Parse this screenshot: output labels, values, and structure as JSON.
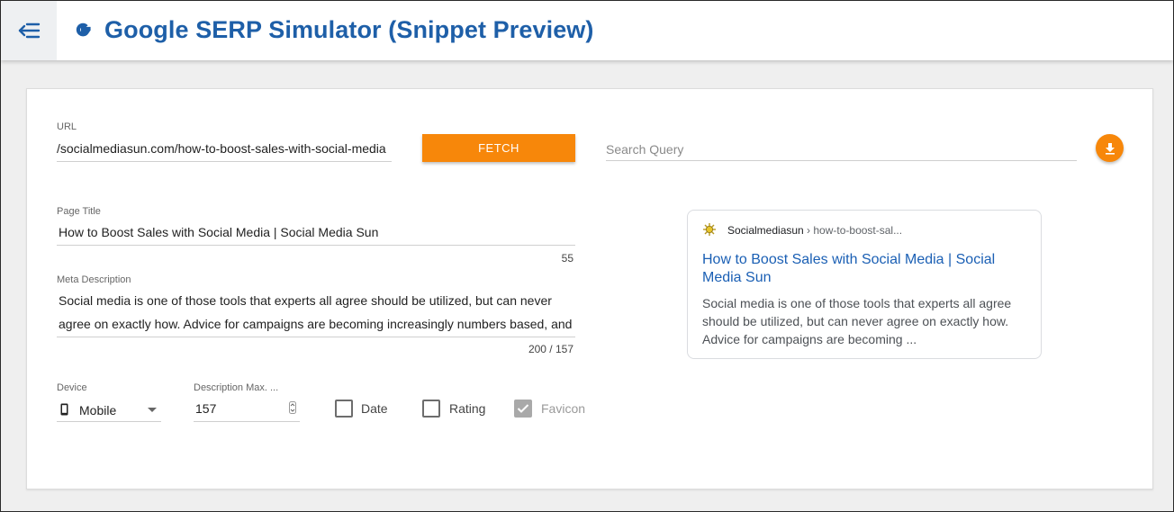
{
  "app": {
    "title": "Google SERP Simulator (Snippet Preview)"
  },
  "colors": {
    "brand_blue": "#1e5fa8",
    "accent_orange": "#f7870a",
    "link_blue": "#1a5fb4"
  },
  "form": {
    "url_label": "URL",
    "url_value": "socialmediasun.com/how-to-boost-sales-with-social-media/",
    "fetch_label": "FETCH",
    "search_placeholder": "Search Query",
    "page_title_label": "Page Title",
    "page_title_value": "How to Boost Sales with Social Media | Social Media Sun",
    "title_counter": "55",
    "meta_label": "Meta Description",
    "meta_line1": "Social media is one of those tools that experts all agree should be utilized, but can never",
    "meta_line2": "agree on exactly how. Advice for campaigns are becoming increasingly numbers based, and",
    "meta_counter": "200 / 157",
    "device_label": "Device",
    "device_value": "Mobile",
    "desc_max_label": "Description Max. ...",
    "desc_max_value": "157",
    "date_label": "Date",
    "rating_label": "Rating",
    "favicon_label": "Favicon"
  },
  "preview": {
    "site": "Socialmediasun",
    "crumb": " › how-to-boost-sal...",
    "title": "How to Boost Sales with Social Media | Social Media Sun",
    "description": "Social media is one of those tools that experts all agree should be utilized, but can never agree on exactly how. Advice for campaigns are becoming ..."
  }
}
